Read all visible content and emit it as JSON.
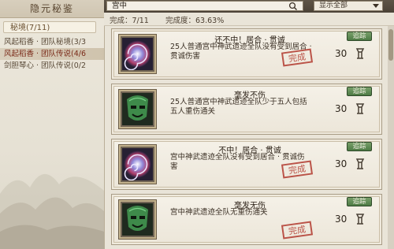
{
  "sidebar": {
    "title": "隐元秘鉴",
    "category": "秘境(7/11)",
    "items": [
      {
        "label": "风起稻香 · 团队秘境(3/3"
      },
      {
        "label": "风起稻香 · 团队传说(4/6"
      },
      {
        "label": "剑胆琴心 · 团队传说(0/2"
      }
    ]
  },
  "topbar": {
    "search_value": "宫中",
    "filter_value": "显示全部"
  },
  "stats": {
    "completed": "完成：7/11",
    "progress": "完成度：63.63%"
  },
  "achievements": [
    {
      "title": "还不中！居合 · 贯诚",
      "desc": "25人普通宫中神武遗迹全队没有受到居合 · 贯诚伤害",
      "button": "追踪",
      "points": "30",
      "seal": "完成",
      "icon": "vortex-icon"
    },
    {
      "title": "毫发不伤",
      "desc": "25人普通宫中神武遗迹全队少于五人包括五人重伤通关",
      "button": "追踪",
      "points": "30",
      "seal": "",
      "icon": "green-mask-icon"
    },
    {
      "title": "不中！居合 · 贯诚",
      "desc": "宫中神武遗迹全队没有受到居合 · 贯诚伤害",
      "button": "追踪",
      "points": "30",
      "seal": "完成",
      "icon": "vortex-icon"
    },
    {
      "title": "毫发无伤",
      "desc": "宫中神武遗迹全队无重伤通关",
      "button": "追踪",
      "points": "30",
      "seal": "完成",
      "icon": "green-mask-icon"
    }
  ],
  "colors": {
    "seal": "#b23a2f",
    "button": "#5a8a50",
    "topbar": "#524840"
  }
}
